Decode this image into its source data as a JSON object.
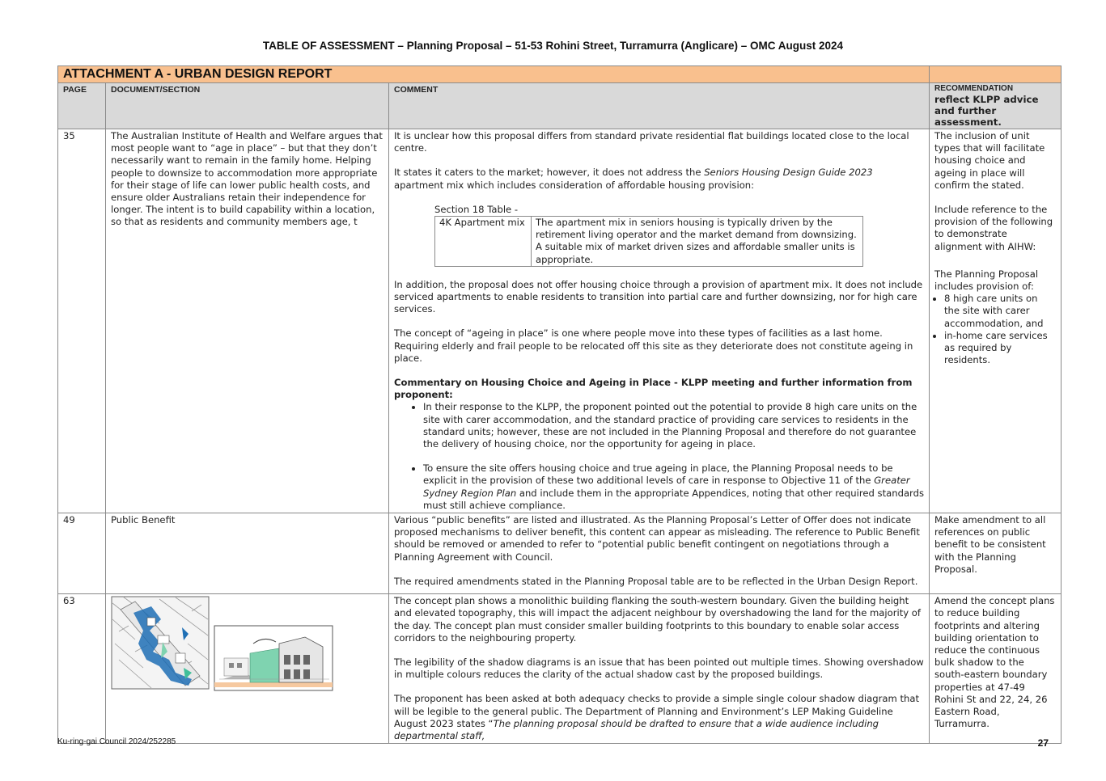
{
  "doc": {
    "title": "TABLE OF ASSESSMENT – Planning Proposal – 51-53 Rohini Street, Turramurra (Anglicare) – OMC August 2024"
  },
  "table": {
    "section_title": "ATTACHMENT A - URBAN DESIGN REPORT",
    "headers": {
      "page": "PAGE",
      "document": "DOCUMENT/SECTION",
      "comment": "COMMENT",
      "recommendation_small": "RECOMMENDATION",
      "recommendation_big": "reflect KLPP advice and further assessment."
    },
    "rows": [
      {
        "page": "35",
        "document": "The Australian Institute of Health and Welfare argues that most people want to “age in place” – but that they don’t necessarily want to remain in the family home. Helping people to downsize to accommodation more appropriate for their stage of life can lower public health costs, and ensure older Australians retain their independence for longer. The intent is to build capability within a location, so that as residents and community members age, t",
        "comment": {
          "p1": "It is unclear how this proposal differs from standard private residential flat buildings located close to the local centre.",
          "p2_before": "It states it caters to the market; however, it does not address the ",
          "p2_italic": "Seniors Housing Design Guide 2023",
          "p2_after": " apartment mix which includes consideration of affordable housing provision:",
          "table_caption": "Section 18 Table -",
          "table_label": "4K Apartment mix",
          "table_text": "The apartment mix in seniors housing is typically driven by the retirement living operator and the market demand from downsizing. A suitable mix of market driven sizes and affordable smaller units is appropriate.",
          "p3": "In addition, the proposal does not offer housing choice through a provision of apartment mix. It does not include serviced apartments to enable residents to transition into partial care and further downsizing, nor for high care services.",
          "p4": "The concept of “ageing in place” is one where people move into these types of facilities as a last home. Requiring elderly and frail people to be relocated off this site as they deteriorate does not constitute ageing in place.",
          "heading": "Commentary on Housing Choice and Ageing in Place - KLPP meeting and further information from proponent:",
          "bullet1": "In their response to the KLPP, the proponent pointed out the potential to provide 8 high care units on the site with carer accommodation, and the standard practice of providing care services to residents in the standard units; however, these are not included in the Planning Proposal and therefore do not guarantee the delivery of housing choice, nor the opportunity for ageing in place.",
          "bullet2_before": "To ensure the site offers housing choice and true ageing in place, the Planning Proposal needs to be explicit in the provision of these two additional levels of care in response to Objective 11 of the ",
          "bullet2_italic": "Greater Sydney Region Plan",
          "bullet2_after": " and include them in the appropriate Appendices, noting that other required standards must still achieve compliance."
        },
        "recommendation": {
          "p1": "The inclusion of unit types that will facilitate housing choice and ageing in place will confirm the stated.",
          "p2": "Include reference to the provision of the following to demonstrate alignment with AIHW:",
          "p3": "The Planning Proposal includes provision of:",
          "items": [
            "8 high care units on the site with carer accommodation, and",
            "in-home care services as required by residents."
          ]
        }
      },
      {
        "page": "49",
        "document": "Public Benefit",
        "comment": {
          "p1": "Various “public benefits” are listed and illustrated. As the Planning Proposal’s Letter of Offer does not indicate proposed mechanisms to deliver benefit, this content can appear as misleading. The reference to Public Benefit should be removed or amended to refer to “potential public benefit contingent on negotiations through a Planning Agreement with Council.",
          "p2": "The required amendments stated in the Planning Proposal table are to be reflected in the Urban Design Report."
        },
        "recommendation": "Make amendment to all references on public benefit to be consistent with the Planning Proposal."
      },
      {
        "page": "63",
        "comment": {
          "p1": "The concept plan shows a monolithic building flanking the south-western boundary. Given the building height and elevated topography, this will impact the adjacent neighbour by overshadowing the land for the majority of the day. The concept plan must consider smaller building footprints to this boundary to enable solar access corridors to the neighbouring property.",
          "p2": "The legibility of the shadow diagrams is an issue that has been pointed out multiple times. Showing overshadow in multiple colours reduces the clarity of the actual shadow cast by the proposed buildings.",
          "p3_before": "The proponent has been asked at both adequacy checks to provide a simple single colour shadow diagram that will be legible to the general public. The Department of Planning and Environment’s LEP Making Guideline August 2023 states “",
          "p3_italic": "The planning proposal should be drafted to ensure that a wide audience including departmental staff,"
        },
        "recommendation": "Amend the concept plans to reduce building footprints and altering building orientation to reduce the continuous bulk shadow to the south-eastern boundary properties at 47-49 Rohini St and 22, 24, 26 Eastern Road, Turramurra."
      }
    ]
  },
  "footer": {
    "reference": "Ku-ring-gai Council 2024/252285",
    "page_number": "27"
  },
  "colors": {
    "band": "#f9c08e",
    "header": "#d9d9d9",
    "shadow_blue": "#1f6fb5",
    "building_green": "#7fd3b0"
  }
}
